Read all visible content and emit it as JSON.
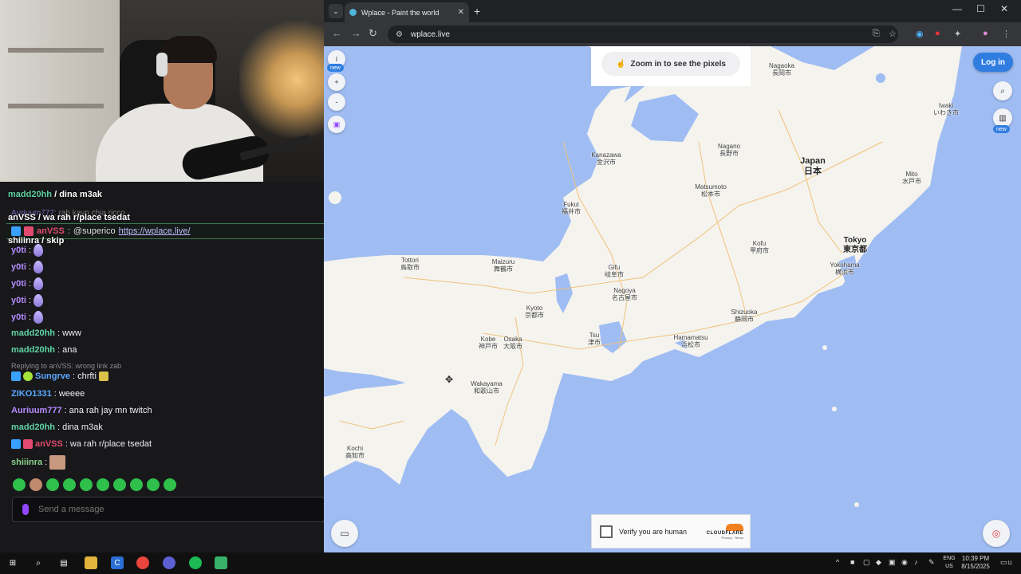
{
  "chat": {
    "overlay_lines": [
      {
        "user": "madd20hh",
        "text": "dina m3ak"
      },
      {
        "user": "anVSS",
        "text": "wa rah r/place tsedat"
      },
      {
        "user": "shiiinra",
        "text": "skip"
      }
    ],
    "ghost_lines": [
      {
        "text": "rah kayn chia ricco"
      }
    ],
    "pinned": {
      "user": "anVSS",
      "text": "@superico",
      "link": "https://wplace.live/"
    },
    "messages": [
      {
        "user": "y0ti",
        "color": "#b58bff",
        "text": "",
        "drop": true
      },
      {
        "user": "y0ti",
        "color": "#b58bff",
        "text": "",
        "drop": true
      },
      {
        "user": "y0ti",
        "color": "#b58bff",
        "text": "",
        "drop": true
      },
      {
        "user": "y0ti",
        "color": "#b58bff",
        "text": "",
        "drop": true
      },
      {
        "user": "y0ti",
        "color": "#b58bff",
        "text": "",
        "drop": true
      },
      {
        "user": "madd20hh",
        "color": "#5fd3a3",
        "text": "www"
      },
      {
        "user": "madd20hh",
        "color": "#5fd3a3",
        "text": "ana"
      }
    ],
    "reply_hint": "Replying to anVSS: wrong link zab",
    "messages2": [
      {
        "user": "Sungrve",
        "color": "#5aa8ff",
        "text": "chrfti"
      },
      {
        "user": "ZIKO1331",
        "color": "#5aa8ff",
        "text": "weeee"
      },
      {
        "user": "Auriuum777",
        "color": "#b58bff",
        "text": "ana rah jay mn twitch"
      },
      {
        "user": "madd20hh",
        "color": "#5fd3a3",
        "text": "dina m3ak"
      },
      {
        "user": "anVSS",
        "color": "#e34a6f",
        "text": "wa rah r/place tsedat"
      },
      {
        "user": "shiiinra",
        "color": "#8ad18a",
        "text": ""
      }
    ],
    "input_placeholder": "Send a message"
  },
  "browser": {
    "tab_title": "Wplace - Paint the world",
    "url": "wplace.live"
  },
  "map": {
    "zoom_hint": "Zoom in to see the pixels",
    "login_label": "Log in",
    "info_label": "i",
    "new_badge": "new",
    "zoom_in": "+",
    "zoom_out": "-",
    "captcha_label": "Verify you are human",
    "captcha_brand": "CLOUDFLARE",
    "captcha_links": "Privacy · Terms",
    "cities": [
      {
        "name": "Nagaoka",
        "jp": "長岡市"
      },
      {
        "name": "Iwaki",
        "jp": "いわき市"
      },
      {
        "name": "Nagano",
        "jp": "長野市"
      },
      {
        "name": "Kanazawa",
        "jp": "金沢市"
      },
      {
        "name": "Japan",
        "jp": "日本"
      },
      {
        "name": "Mito",
        "jp": "水戸市"
      },
      {
        "name": "Matsumoto",
        "jp": "松本市"
      },
      {
        "name": "Fukui",
        "jp": "福井市"
      },
      {
        "name": "Kofu",
        "jp": "甲府市"
      },
      {
        "name": "Tokyo",
        "jp": "東京都"
      },
      {
        "name": "Tottori",
        "jp": "鳥取市"
      },
      {
        "name": "Maizuru",
        "jp": "舞鶴市"
      },
      {
        "name": "Gifu",
        "jp": "岐阜市"
      },
      {
        "name": "Yokohama",
        "jp": "横浜市"
      },
      {
        "name": "Nagoya",
        "jp": "名古屋市"
      },
      {
        "name": "Kyoto",
        "jp": "京都市"
      },
      {
        "name": "Shizuoka",
        "jp": "静岡市"
      },
      {
        "name": "Kobe",
        "jp": "神戸市"
      },
      {
        "name": "Osaka",
        "jp": "大阪市"
      },
      {
        "name": "Tsu",
        "jp": "津市"
      },
      {
        "name": "Hamamatsu",
        "jp": "浜松市"
      },
      {
        "name": "Wakayama",
        "jp": "和歌山市"
      },
      {
        "name": "Kochi",
        "jp": "高知市"
      }
    ]
  },
  "taskbar": {
    "lang1": "ENG",
    "lang2": "US",
    "time": "10:39 PM",
    "date": "8/15/2025",
    "notif": "11"
  },
  "colors": {
    "map_water": "#9fbdf3",
    "land": "#f5f3ee",
    "accent_blue": "#2f7de1",
    "twitch_purple": "#9147ff"
  }
}
